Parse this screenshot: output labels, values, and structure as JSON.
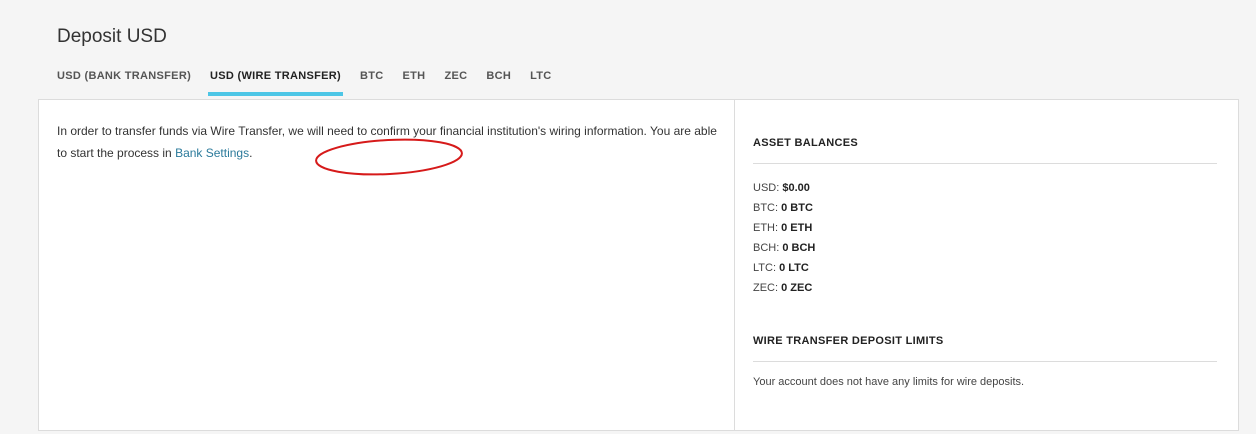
{
  "page": {
    "title": "Deposit USD"
  },
  "tabs": [
    {
      "label": "USD (BANK TRANSFER)",
      "active": false
    },
    {
      "label": "USD (WIRE TRANSFER)",
      "active": true
    },
    {
      "label": "BTC",
      "active": false
    },
    {
      "label": "ETH",
      "active": false
    },
    {
      "label": "ZEC",
      "active": false
    },
    {
      "label": "BCH",
      "active": false
    },
    {
      "label": "LTC",
      "active": false
    }
  ],
  "main": {
    "intro_text": "In order to transfer funds via Wire Transfer, we will need to confirm your financial institution's wiring information. You are able to start the process in ",
    "link_label": "Bank Settings",
    "trailing": "."
  },
  "sidebar": {
    "balances_heading": "ASSET BALANCES",
    "balances": [
      {
        "label": "USD:",
        "value": "$0.00"
      },
      {
        "label": "BTC:",
        "value": "0 BTC"
      },
      {
        "label": "ETH:",
        "value": "0 ETH"
      },
      {
        "label": "BCH:",
        "value": "0 BCH"
      },
      {
        "label": "LTC:",
        "value": "0 LTC"
      },
      {
        "label": "ZEC:",
        "value": "0 ZEC"
      }
    ],
    "limits_heading": "WIRE TRANSFER DEPOSIT LIMITS",
    "limits_text": "Your account does not have any limits for wire deposits."
  },
  "colors": {
    "accent_tab_underline": "#4dc6e6",
    "link": "#2b7a9b",
    "annotation_circle": "#d61a1a"
  }
}
